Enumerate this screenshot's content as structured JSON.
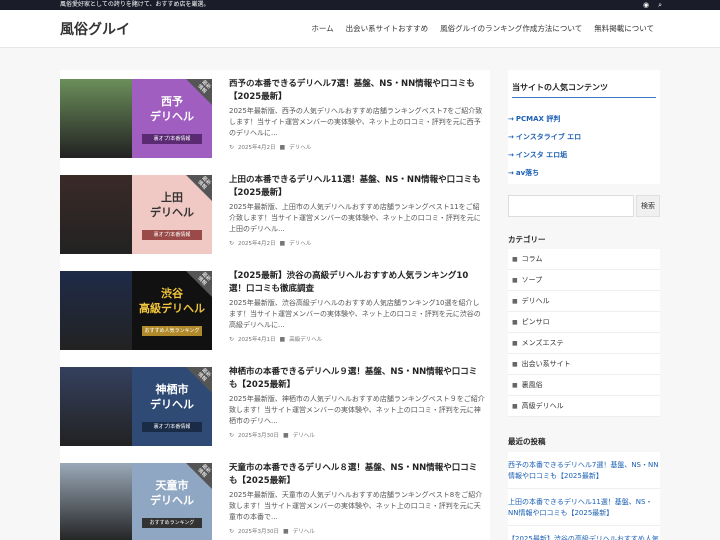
{
  "topbar": {
    "tagline": "風俗愛好家としての誇りを賭けて、おすすめ店を厳選。",
    "icons": [
      "rss-icon",
      "search-icon"
    ]
  },
  "header": {
    "site_title": "風俗グルイ",
    "nav": [
      "ホーム",
      "出会い系サイトおすすめ",
      "風俗グルイのランキング作成方法について",
      "無料掲載について"
    ]
  },
  "posts": [
    {
      "title": "西予の本番できるデリヘル7選！基盤、NS・NN情報や口コミも【2025最新】",
      "excerpt": "2025年最新版、西予の人気デリヘルおすすめ店舗ランキングベスト7をご紹介致します！当サイト運営メンバーの実体験や、ネット上の口コミ・評判を元に西予のデリヘルに...",
      "date": "2025年4月2日",
      "category": "デリヘル",
      "thumb_title": "西予\nデリヘル",
      "thumb_badge": "裏オプ/本番情報",
      "thumb_corner": "最新情報",
      "panel_color": "#a05fc0",
      "text_color": "#ffffff",
      "badge_color": "#5a2b73",
      "photo_color": "#6b8f5a"
    },
    {
      "title": "上田の本番できるデリヘル11選！基盤、NS・NN情報や口コミも【2025最新】",
      "excerpt": "2025年最新版、上田市の人気デリヘルおすすめ店舗ランキングベスト11をご紹介致します！当サイト運営メンバーの実体験や、ネット上の口コミ・評判を元に上田のデリヘル...",
      "date": "2025年4月2日",
      "category": "デリヘル",
      "thumb_title": "上田\nデリヘル",
      "thumb_badge": "裏オプ/本番情報",
      "thumb_corner": "最新情報",
      "panel_color": "#f1c9c4",
      "text_color": "#333333",
      "badge_color": "#9a4a48",
      "photo_color": "#3a2a28"
    },
    {
      "title": "【2025最新】渋谷の高級デリヘルおすすめ人気ランキング10選！口コミも徹底調査",
      "excerpt": "2025年最新版、渋谷高級デリヘルのおすすめ人気店舗ランキング10選を紹介します！当サイト運営メンバーの実体験や、ネット上の口コミ・評判を元に渋谷の高級デリヘルに...",
      "date": "2025年4月1日",
      "category": "高級デリヘル",
      "thumb_title": "渋谷\n高級デリヘル",
      "thumb_badge": "おすすめ人気ランキング",
      "thumb_corner": "最新情報",
      "panel_color": "#111111",
      "text_color": "#f0c43c",
      "badge_color": "#b08a2a",
      "photo_color": "#1e2b48"
    },
    {
      "title": "神栖市の本番できるデリヘル９選！基盤、NS・NN情報や口コミも【2025最新】",
      "excerpt": "2025年最新版、神栖市の人気デリヘルおすすめ店舗ランキングベスト９をご紹介致します！当サイト運営メンバーの実体験や、ネット上の口コミ・評判を元に神栖市のデリヘ...",
      "date": "2025年3月30日",
      "category": "デリヘル",
      "thumb_title": "神栖市\nデリヘル",
      "thumb_badge": "裏オプ/本番情報",
      "thumb_corner": "最新情報",
      "panel_color": "#2f4a75",
      "text_color": "#ffffff",
      "badge_color": "#1a2b48",
      "photo_color": "#34405e"
    },
    {
      "title": "天童市の本番できるデリヘル８選！基盤、NS・NN情報や口コミも【2025最新】",
      "excerpt": "2025年最新版、天童市の人気デリヘルおすすめ店舗ランキングベスト8をご紹介致します！当サイト運営メンバーの実体験や、ネット上の口コミ・評判を元に天童市の本番で...",
      "date": "2025年3月30日",
      "category": "デリヘル",
      "thumb_title": "天童市\nデリヘル",
      "thumb_badge": "おすすめランキング",
      "thumb_corner": "最新情報",
      "panel_color": "#8fa7c2",
      "text_color": "#ffffff",
      "badge_color": "#333333",
      "photo_color": "#9aa9b8"
    }
  ],
  "sidebar": {
    "popular_heading": "当サイトの人気コンテンツ",
    "popular": [
      "PCMAX 評判",
      "インスタライブ エロ",
      "インスタ エロ垢",
      "av落ち"
    ],
    "search_placeholder": "",
    "search_button": "検索",
    "category_heading": "カテゴリー",
    "categories": [
      "コラム",
      "ソープ",
      "デリヘル",
      "ピンサロ",
      "メンズエステ",
      "出会い系サイト",
      "裏風俗",
      "高級デリヘル"
    ],
    "recent_heading": "最近の投稿",
    "recent": [
      "西予の本番できるデリヘル7選！基盤、NS・NN情報や口コミも【2025最新】",
      "上田の本番できるデリヘル11選！基盤、NS・NN情報や口コミも【2025最新】",
      "【2025最新】渋谷の高級デリヘルおすすめ人気"
    ]
  }
}
